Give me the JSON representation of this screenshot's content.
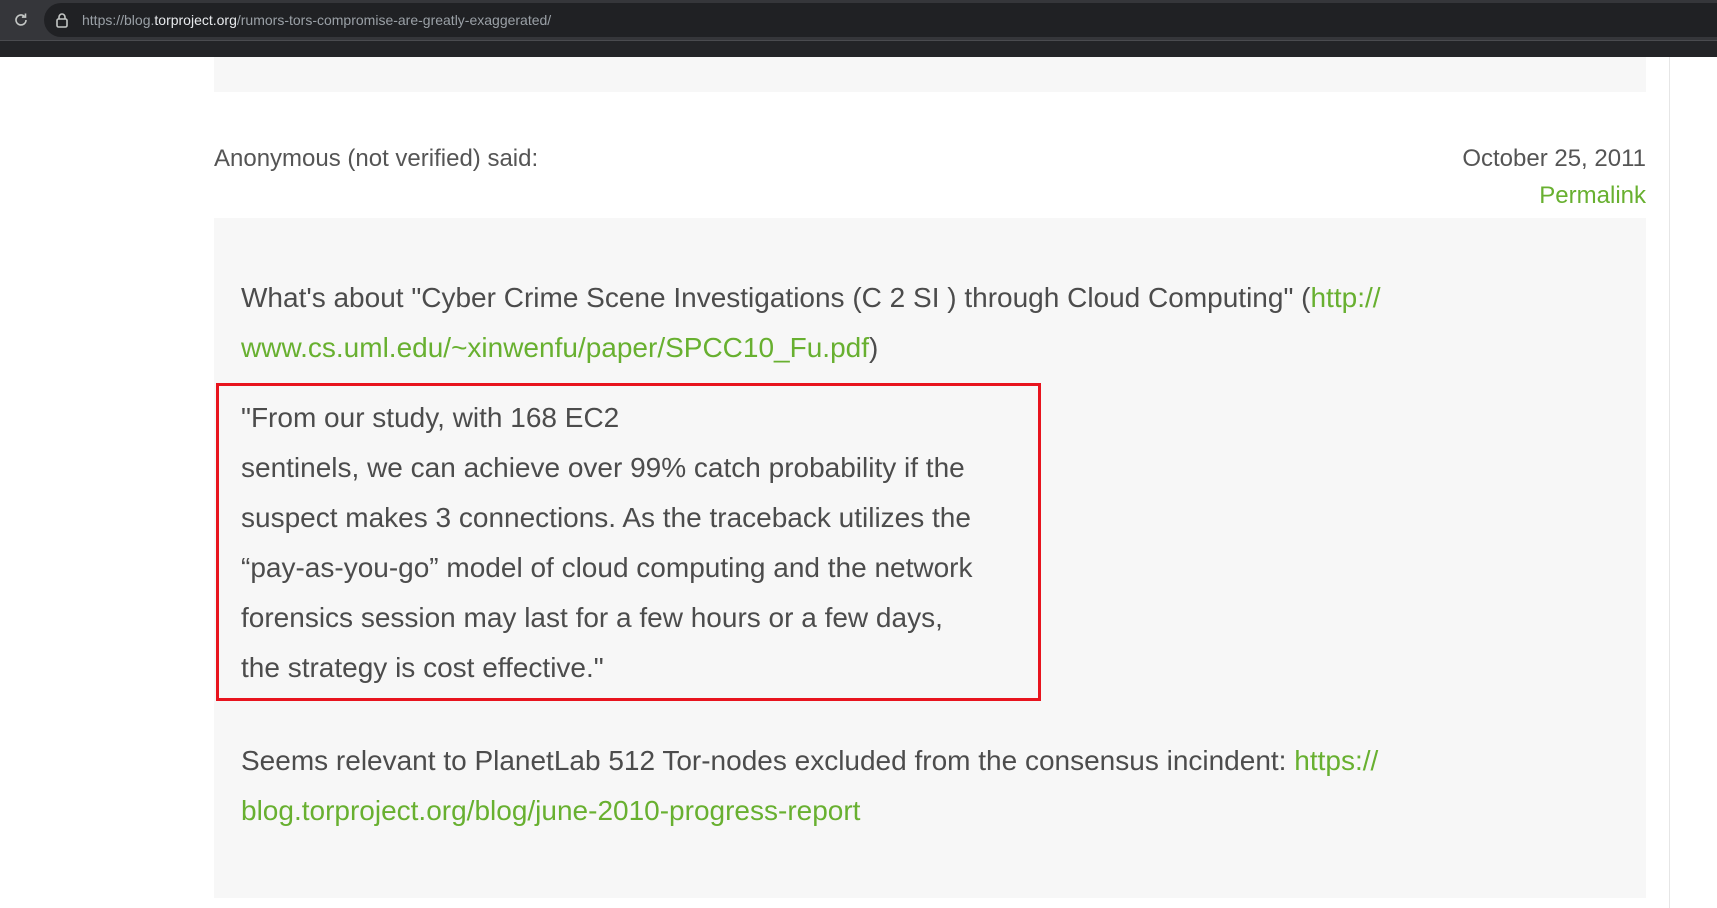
{
  "browser": {
    "url_prefix": "https://blog.",
    "url_domain": "torproject.org",
    "url_path": "/rumors-tors-compromise-are-greatly-exaggerated/",
    "icons": {
      "reload": "reload-icon",
      "lock": "lock-icon"
    }
  },
  "comment": {
    "author": "Anonymous (not verified) said:",
    "date": "October 25, 2011",
    "permalink": "Permalink",
    "p1": {
      "text_before": "What's about \"Cyber Crime Scene Investigations (C 2 SI ) through Cloud Computing\" (",
      "link_line1": "http://",
      "link_line2": "www.cs.uml.edu/~xinwenfu/paper/SPCC10_Fu.pdf",
      "text_after": ")"
    },
    "quote_lines": [
      "\"From our study, with 168 EC2",
      "sentinels, we can achieve over 99% catch probability if the",
      "suspect makes 3 connections. As the traceback utilizes the",
      "“pay-as-you-go” model of cloud computing and the network",
      "forensics session may last for a few hours or a few days,",
      "the strategy is cost effective.\""
    ],
    "p3": {
      "text_before": "Seems relevant to PlanetLab 512 Tor-nodes excluded from the consensus incindent: ",
      "link_line1": "https://",
      "link_line2": "blog.torproject.org/blog/june-2010-progress-report"
    }
  },
  "colors": {
    "link": "#68b030",
    "highlight": "#e8141e",
    "comment_bg": "#f7f7f7",
    "chrome": "#35363a"
  }
}
